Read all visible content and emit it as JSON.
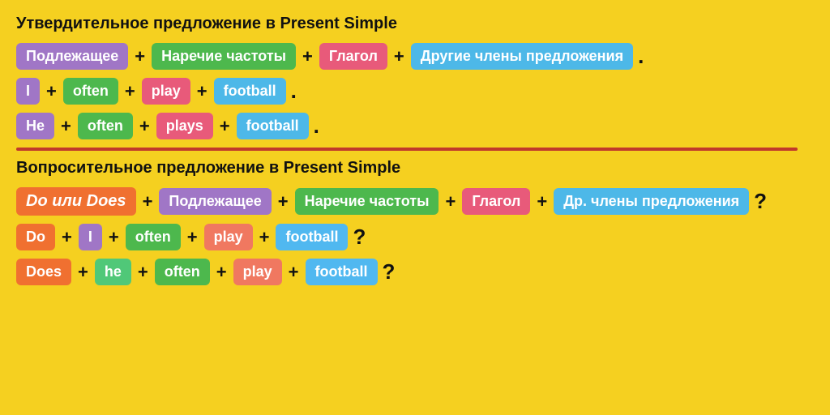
{
  "section1": {
    "title": "Утвердительное предложение в Present Simple",
    "formula": {
      "subject": "Подлежащее",
      "adverb": "Наречие частоты",
      "verb": "Глагол",
      "other": "Другие члены предложения"
    },
    "example1": {
      "subject": "I",
      "adverb": "often",
      "verb": "play",
      "other": "football"
    },
    "example2": {
      "subject": "He",
      "adverb": "often",
      "verb": "plays",
      "other": "football"
    }
  },
  "section2": {
    "title": "Вопросительное предложение в Present Simple",
    "formula": {
      "do_does": "Do или Does",
      "subject": "Подлежащее",
      "adverb": "Наречие частоты",
      "verb": "Глагол",
      "other": "Др. члены предложения"
    },
    "example1": {
      "do_does": "Do",
      "subject": "I",
      "adverb": "often",
      "verb": "play",
      "other": "football"
    },
    "example2": {
      "do_does": "Does",
      "subject": "he",
      "adverb": "often",
      "verb": "play",
      "other": "football"
    }
  },
  "operators": {
    "plus": "+",
    "dot": ".",
    "question": "?"
  }
}
